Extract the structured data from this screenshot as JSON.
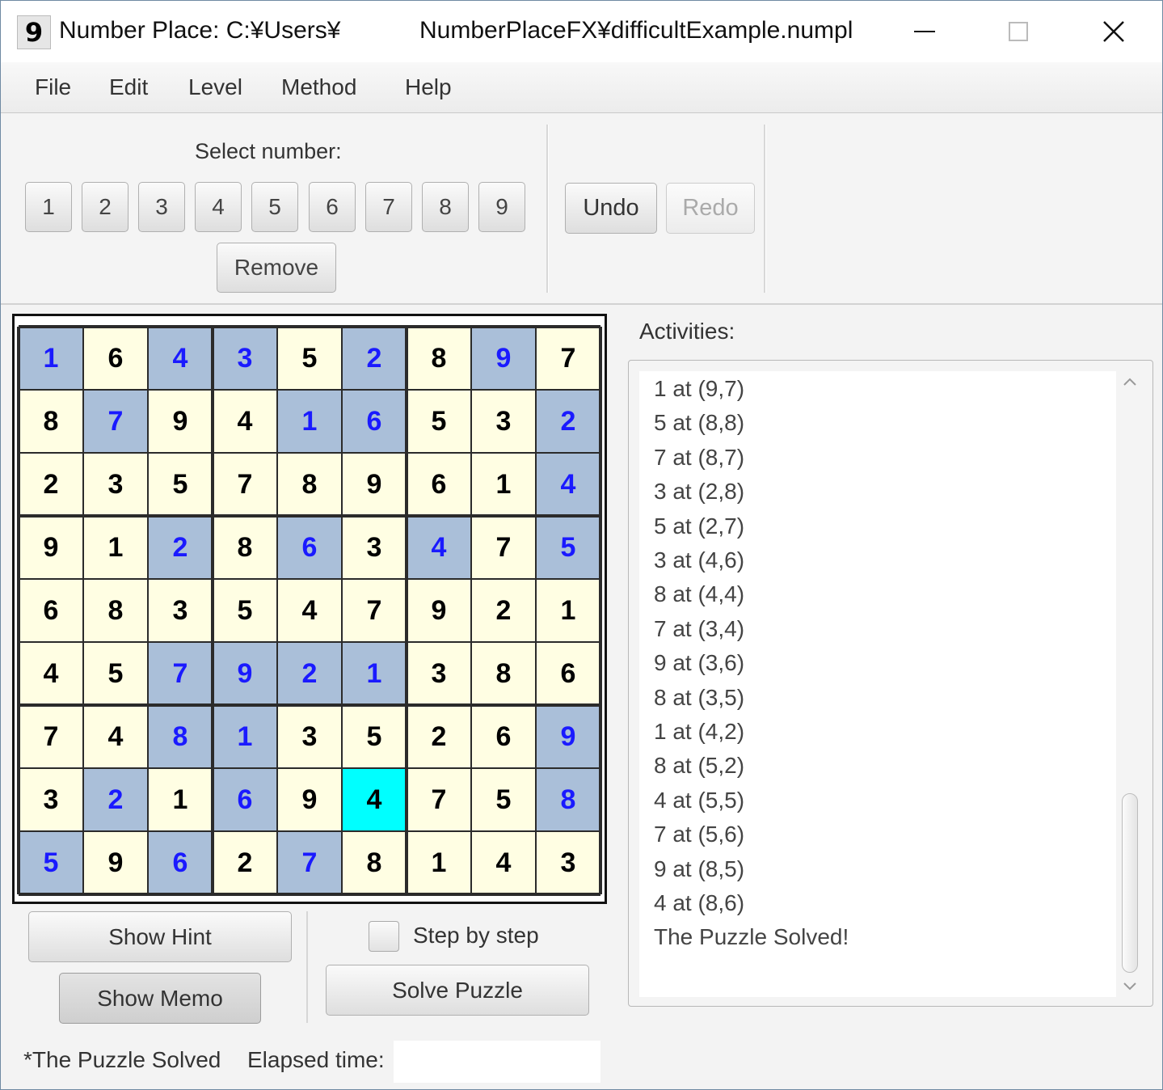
{
  "window": {
    "title_part1": "Number Place: C:¥Users¥",
    "title_part2": "NumberPlaceFX¥difficultExample.numpl",
    "app_icon_glyph": "9"
  },
  "menu": [
    {
      "label": "File"
    },
    {
      "label": "Edit"
    },
    {
      "label": "Level"
    },
    {
      "label": "Method"
    },
    {
      "label": "Help"
    }
  ],
  "toolbar": {
    "select_label": "Select number:",
    "numbers": [
      "1",
      "2",
      "3",
      "4",
      "5",
      "6",
      "7",
      "8",
      "9"
    ],
    "remove_label": "Remove",
    "undo_label": "Undo",
    "redo_label": "Redo"
  },
  "board": {
    "rows": [
      [
        "1",
        "6",
        "4",
        "3",
        "5",
        "2",
        "8",
        "9",
        "7"
      ],
      [
        "8",
        "7",
        "9",
        "4",
        "1",
        "6",
        "5",
        "3",
        "2"
      ],
      [
        "2",
        "3",
        "5",
        "7",
        "8",
        "9",
        "6",
        "1",
        "4"
      ],
      [
        "9",
        "1",
        "2",
        "8",
        "6",
        "3",
        "4",
        "7",
        "5"
      ],
      [
        "6",
        "8",
        "3",
        "5",
        "4",
        "7",
        "9",
        "2",
        "1"
      ],
      [
        "4",
        "5",
        "7",
        "9",
        "2",
        "1",
        "3",
        "8",
        "6"
      ],
      [
        "7",
        "4",
        "8",
        "1",
        "3",
        "5",
        "2",
        "6",
        "9"
      ],
      [
        "3",
        "2",
        "1",
        "6",
        "9",
        "4",
        "7",
        "5",
        "8"
      ],
      [
        "5",
        "9",
        "6",
        "2",
        "7",
        "8",
        "1",
        "4",
        "3"
      ]
    ],
    "solved_mask": [
      [
        1,
        0,
        1,
        1,
        0,
        1,
        0,
        1,
        0
      ],
      [
        0,
        1,
        0,
        0,
        1,
        1,
        0,
        0,
        1
      ],
      [
        0,
        0,
        0,
        0,
        0,
        0,
        0,
        0,
        1
      ],
      [
        0,
        0,
        1,
        0,
        1,
        0,
        1,
        0,
        1
      ],
      [
        0,
        0,
        0,
        0,
        0,
        0,
        0,
        0,
        0
      ],
      [
        0,
        0,
        1,
        1,
        1,
        1,
        0,
        0,
        0
      ],
      [
        0,
        0,
        1,
        1,
        0,
        0,
        0,
        0,
        1
      ],
      [
        0,
        1,
        0,
        1,
        0,
        0,
        0,
        0,
        1
      ],
      [
        1,
        0,
        1,
        0,
        1,
        0,
        0,
        0,
        0
      ]
    ],
    "selected_cell": {
      "row": 8,
      "col": 6
    },
    "colors": {
      "given_bg": "#fffee3",
      "solved_bg": "#aabfd9",
      "selected_bg": "#00ffff",
      "given_text": "#000000",
      "solved_text": "#1a1aff"
    }
  },
  "controls": {
    "show_hint_label": "Show Hint",
    "show_memo_label": "Show Memo",
    "step_by_step_label": "Step by step",
    "solve_label": "Solve Puzzle"
  },
  "status": {
    "solved_text": "*The Puzzle Solved",
    "elapsed_label": "Elapsed time:",
    "elapsed_value": ""
  },
  "activities": {
    "label": "Activities:",
    "items": [
      "1 at (9,7)",
      "5 at (8,8)",
      "7 at (8,7)",
      "3 at (2,8)",
      "5 at (2,7)",
      "3 at (4,6)",
      "8 at (4,4)",
      "7 at (3,4)",
      "9 at (3,6)",
      "8 at (3,5)",
      "1 at (4,2)",
      "8 at (5,2)",
      "4 at (5,5)",
      "7 at (5,6)",
      "9 at (8,5)",
      "4 at (8,6)",
      "The Puzzle Solved!"
    ]
  }
}
